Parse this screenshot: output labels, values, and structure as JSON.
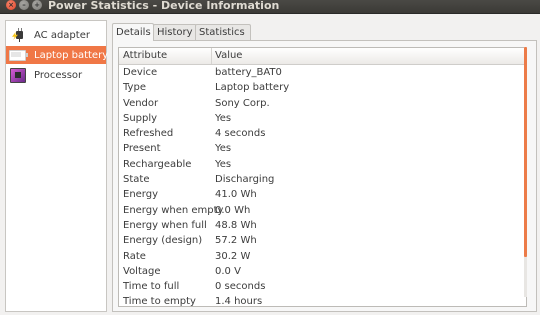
{
  "window": {
    "title": "Power Statistics - Device Information",
    "close_glyph": "×",
    "minimize_glyph": "–",
    "maximize_glyph": "+"
  },
  "devices": [
    {
      "label": "AC adapter",
      "icon": "ac-adapter-icon",
      "selected": false
    },
    {
      "label": "Laptop battery",
      "icon": "battery-icon",
      "selected": true
    },
    {
      "label": "Processor",
      "icon": "processor-icon",
      "selected": false
    }
  ],
  "tabs": [
    {
      "label": "Details",
      "active": true
    },
    {
      "label": "History",
      "active": false
    },
    {
      "label": "Statistics",
      "active": false
    }
  ],
  "table": {
    "headers": {
      "attribute": "Attribute",
      "value": "Value"
    },
    "rows": [
      {
        "attribute": "Device",
        "value": "battery_BAT0"
      },
      {
        "attribute": "Type",
        "value": "Laptop battery"
      },
      {
        "attribute": "Vendor",
        "value": "Sony Corp."
      },
      {
        "attribute": "Supply",
        "value": "Yes"
      },
      {
        "attribute": "Refreshed",
        "value": "4 seconds"
      },
      {
        "attribute": "Present",
        "value": "Yes"
      },
      {
        "attribute": "Rechargeable",
        "value": "Yes"
      },
      {
        "attribute": "State",
        "value": "Discharging"
      },
      {
        "attribute": "Energy",
        "value": "41.0 Wh"
      },
      {
        "attribute": "Energy when empty",
        "value": "0.0 Wh"
      },
      {
        "attribute": "Energy when full",
        "value": "48.8 Wh"
      },
      {
        "attribute": "Energy (design)",
        "value": "57.2 Wh"
      },
      {
        "attribute": "Rate",
        "value": "30.2 W"
      },
      {
        "attribute": "Voltage",
        "value": "0.0 V"
      },
      {
        "attribute": "Time to full",
        "value": "0 seconds"
      },
      {
        "attribute": "Time to empty",
        "value": "1.4 hours"
      }
    ]
  },
  "colors": {
    "accent": "#f07746",
    "titlebar": "#3c3b37",
    "close_button": "#e0452a"
  }
}
